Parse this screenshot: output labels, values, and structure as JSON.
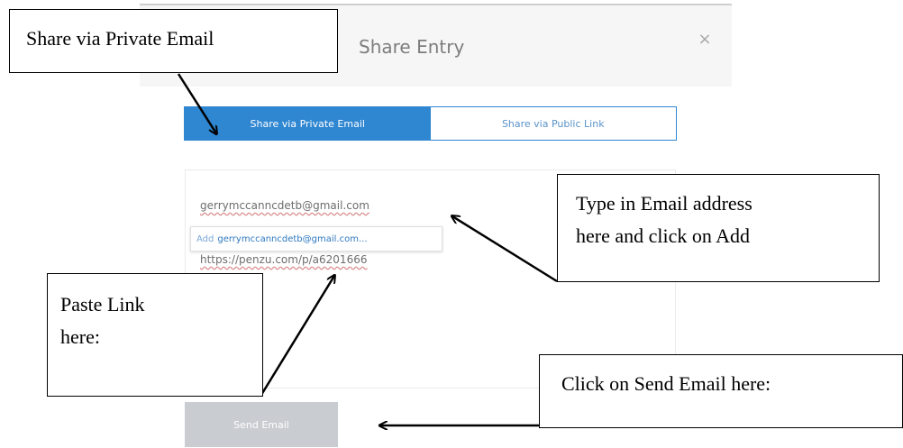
{
  "dialog": {
    "title": "Share Entry",
    "close_glyph": "×",
    "tabs": [
      {
        "label": "Share via Private Email",
        "active": true
      },
      {
        "label": "Share via Public Link",
        "active": false
      }
    ],
    "email_input": {
      "value": "gerrymccanncdetb@gmail.com"
    },
    "suggestion": {
      "prefix": "Add",
      "email": "gerrymccanncdetb@gmail.com..."
    },
    "link_value": "https://penzu.com/p/a6201666",
    "send_button_label": "Send Email"
  },
  "annotations": {
    "share_private": "Share via Private Email",
    "type_email": [
      "Type in Email address",
      "here and click on Add"
    ],
    "paste_link": [
      "Paste Link",
      "here:"
    ],
    "send_email": "Click on Send Email here:"
  },
  "colors": {
    "accent": "#2f86d1",
    "button_disabled": "#c9ccd1",
    "header_bg": "#f6f6f6"
  }
}
